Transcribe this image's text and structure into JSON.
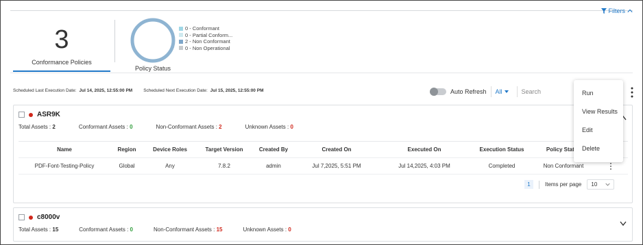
{
  "filters": {
    "label": "Filters"
  },
  "summary": {
    "conformance_count": "3",
    "conformance_label": "Conformance Policies",
    "policy_status_label": "Policy Status",
    "legend": [
      {
        "text": "0 - Conformant",
        "color": "#9fd7e6"
      },
      {
        "text": "0 - Partial Conform...",
        "color": "#cfe9ef"
      },
      {
        "text": "2 - Non Conformant",
        "color": "#7ea6c9"
      },
      {
        "text": "0 - Non Operational",
        "color": "#c6cacd"
      }
    ]
  },
  "schedule": {
    "last_label": "Scheduled Last Execution Date:",
    "last_value": "Jul 14, 2025, 12:55:00 PM",
    "next_label": "Scheduled Next Execution Date:",
    "next_value": "Jul 15, 2025, 12:55:00 PM"
  },
  "toolbar": {
    "auto_refresh_label": "Auto Refresh",
    "filter_select": "All",
    "search_placeholder": "Search"
  },
  "menu": {
    "items": [
      "Run",
      "View Results",
      "Edit",
      "Delete"
    ]
  },
  "cards": [
    {
      "name": "ASR9K",
      "total_label": "Total Assets :",
      "total_value": "2",
      "conformant_label": "Conformant Assets :",
      "conformant_value": "0",
      "nonconformant_label": "Non-Conformant Assets :",
      "nonconformant_value": "2",
      "unknown_label": "Unknown Assets :",
      "unknown_value": "0",
      "columns": [
        "Name",
        "Region",
        "Device Roles",
        "Target Version",
        "Created By",
        "Created On",
        "Executed On",
        "Execution Status",
        "Policy Status"
      ],
      "rows": [
        [
          "PDF-Font-Testing-Policy",
          "Global",
          "Any",
          "7.8.2",
          "admin",
          "Jul 7,2025, 5:51 PM",
          "Jul 14,2025, 4:03 PM",
          "Completed",
          "Non Conformant"
        ]
      ],
      "pager": {
        "page": "1",
        "items_per_page_label": "Items per page",
        "page_size": "10"
      }
    },
    {
      "name": "c8000v",
      "total_label": "Total Assets :",
      "total_value": "15",
      "conformant_label": "Conformant Assets :",
      "conformant_value": "0",
      "nonconformant_label": "Non-Conformant Assets :",
      "nonconformant_value": "15",
      "unknown_label": "Unknown Assets :",
      "unknown_value": "0"
    }
  ]
}
